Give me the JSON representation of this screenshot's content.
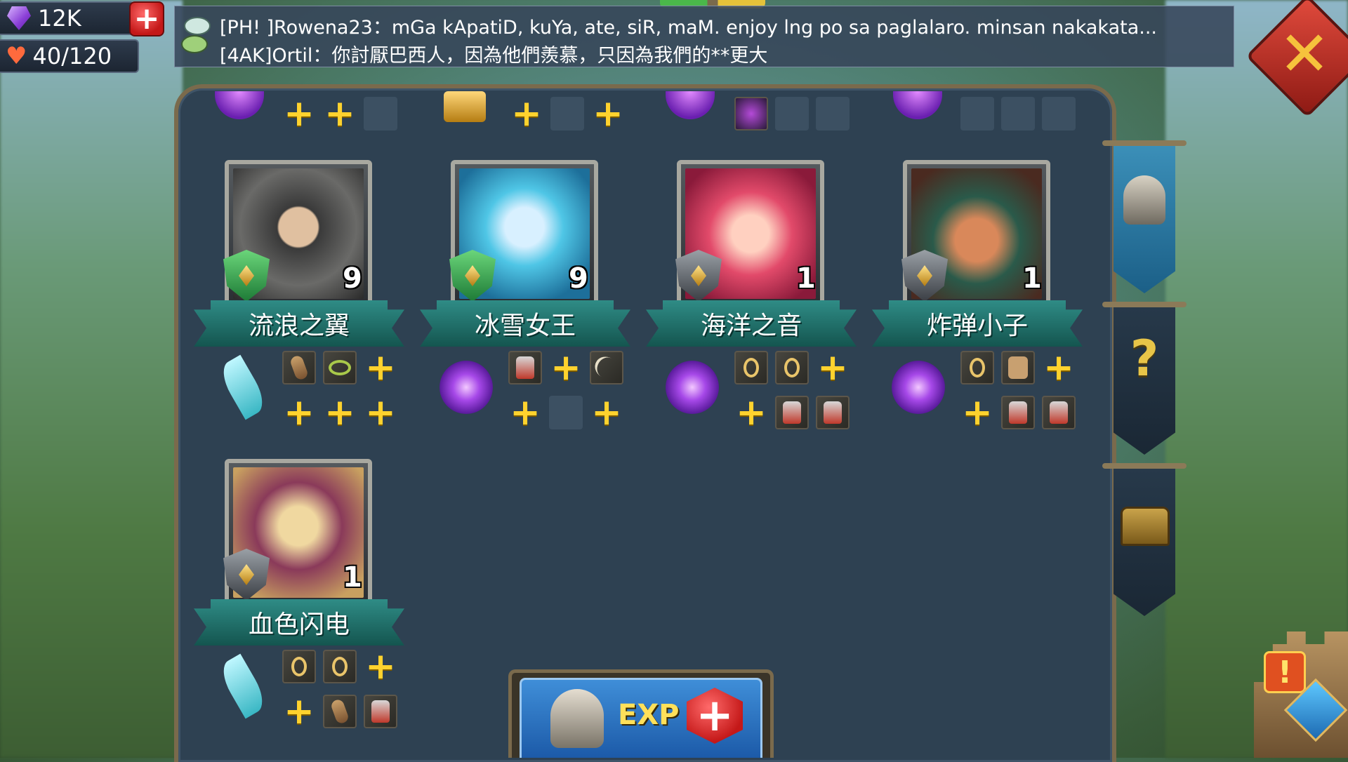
{
  "resources": {
    "gems": "12K",
    "stamina": "40/120"
  },
  "chat": {
    "line1": "[PH! ]Rowena23：mGa kApatiD, kuYa, ate, siR, maM. enjoy lng po sa paglalaro. minsan nakakata...",
    "line2": "[4AK]Ortil：你討厭巴西人，因為他們羨慕，只因為我們的**更大"
  },
  "heroes": [
    {
      "name": "流浪之翼",
      "level": "9"
    },
    {
      "name": "冰雪女王",
      "level": "9"
    },
    {
      "name": "海洋之音",
      "level": "1"
    },
    {
      "name": "炸弹小子",
      "level": "1"
    },
    {
      "name": "血色闪电",
      "level": "1"
    }
  ],
  "exp_button": {
    "label": "EXP"
  },
  "icons": {
    "close": "close-icon",
    "gem": "gem-icon",
    "heart": "heart-icon",
    "add": "plus-icon",
    "side_tabs": [
      "helmet-icon",
      "question-icon",
      "chest-icon"
    ]
  },
  "colors": {
    "panel": "#2e4152",
    "banner": "#1f6f69",
    "plus": "#ffd22e",
    "close": "#e04a3c"
  }
}
